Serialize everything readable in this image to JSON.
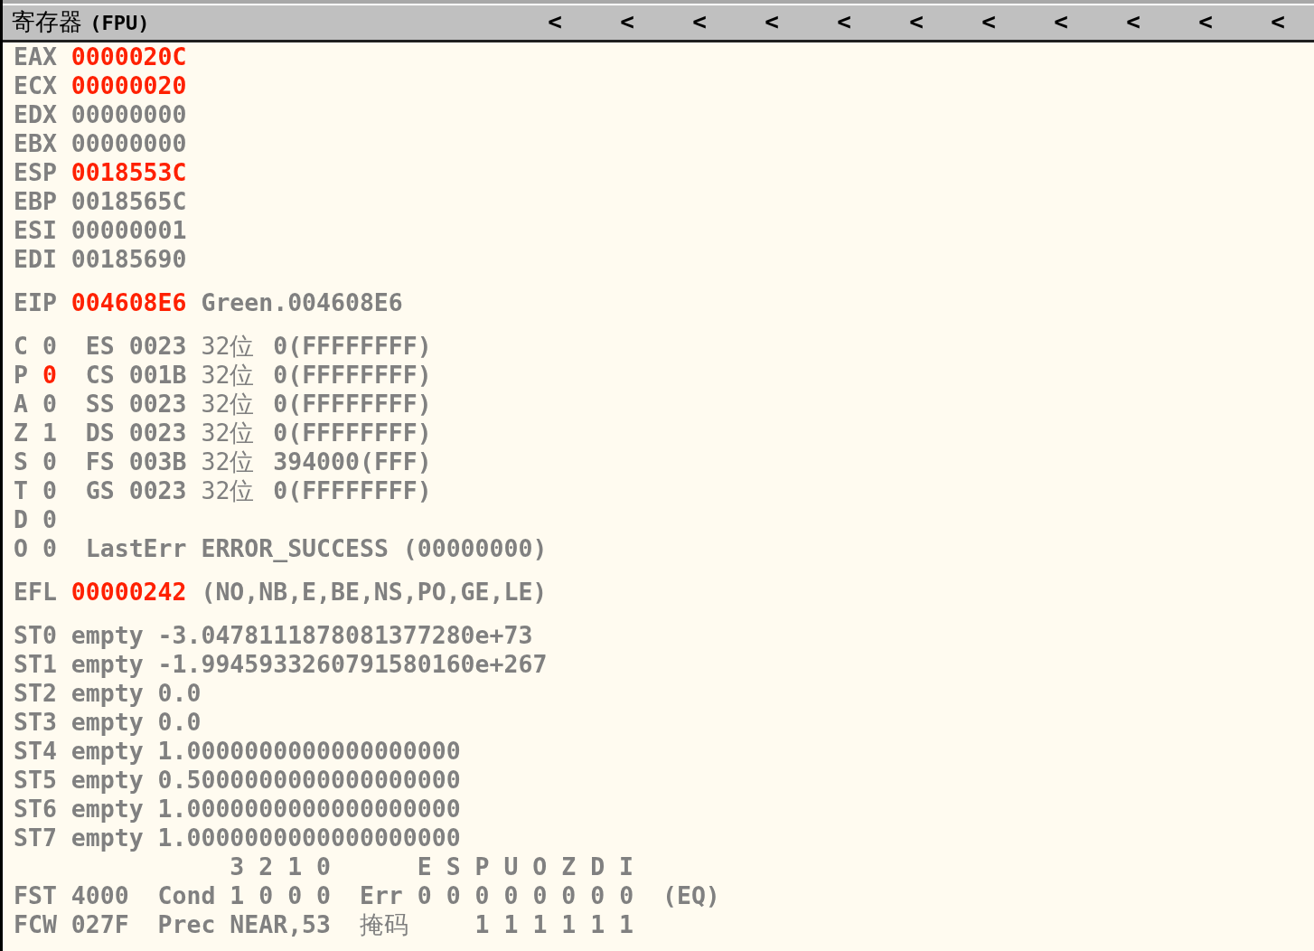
{
  "title": "寄存器 **(FPU)**",
  "scroll_buttons": [
    "<",
    "<",
    "<",
    "<",
    "<",
    "<",
    "<",
    "<",
    "<",
    "<",
    "<"
  ],
  "registers": [
    {
      "name": "EAX",
      "value": "0000020C",
      "changed": true
    },
    {
      "name": "ECX",
      "value": "00000020",
      "changed": true
    },
    {
      "name": "EDX",
      "value": "00000000",
      "changed": false
    },
    {
      "name": "EBX",
      "value": "00000000",
      "changed": false
    },
    {
      "name": "ESP",
      "value": "0018553C",
      "changed": true
    },
    {
      "name": "EBP",
      "value": "0018565C",
      "changed": false
    },
    {
      "name": "ESI",
      "value": "00000001",
      "changed": false
    },
    {
      "name": "EDI",
      "value": "00185690",
      "changed": false
    }
  ],
  "eip": {
    "name": "EIP",
    "value": "004608E6",
    "changed": true,
    "comment": "Green.004608E6"
  },
  "flags": [
    {
      "name": "C",
      "value": "0",
      "changed": false,
      "segment": {
        "name": "ES",
        "selector": "0023",
        "bits": "32位",
        "base": "0(FFFFFFFF)"
      }
    },
    {
      "name": "P",
      "value": "0",
      "changed": true,
      "segment": {
        "name": "CS",
        "selector": "001B",
        "bits": "32位",
        "base": "0(FFFFFFFF)"
      }
    },
    {
      "name": "A",
      "value": "0",
      "changed": false,
      "segment": {
        "name": "SS",
        "selector": "0023",
        "bits": "32位",
        "base": "0(FFFFFFFF)"
      }
    },
    {
      "name": "Z",
      "value": "1",
      "changed": false,
      "segment": {
        "name": "DS",
        "selector": "0023",
        "bits": "32位",
        "base": "0(FFFFFFFF)"
      }
    },
    {
      "name": "S",
      "value": "0",
      "changed": false,
      "segment": {
        "name": "FS",
        "selector": "003B",
        "bits": "32位",
        "base": "394000(FFF)"
      }
    },
    {
      "name": "T",
      "value": "0",
      "changed": false,
      "segment": {
        "name": "GS",
        "selector": "0023",
        "bits": "32位",
        "base": "0(FFFFFFFF)"
      }
    },
    {
      "name": "D",
      "value": "0",
      "changed": false
    },
    {
      "name": "O",
      "value": "0",
      "changed": false,
      "last_error": {
        "label": "LastErr",
        "value": "ERROR_SUCCESS (00000000)"
      }
    }
  ],
  "efl": {
    "name": "EFL",
    "value": "00000242",
    "changed": true,
    "conditions": "(NO,NB,E,BE,NS,PO,GE,LE)"
  },
  "fpu_stack": [
    {
      "name": "ST0",
      "tag": "empty",
      "value": "-3.0478111878081377280e+73"
    },
    {
      "name": "ST1",
      "tag": "empty",
      "value": "-1.9945933260791580160e+267"
    },
    {
      "name": "ST2",
      "tag": "empty",
      "value": "0.0"
    },
    {
      "name": "ST3",
      "tag": "empty",
      "value": "0.0"
    },
    {
      "name": "ST4",
      "tag": "empty",
      "value": "1.0000000000000000000"
    },
    {
      "name": "ST5",
      "tag": "empty",
      "value": "0.5000000000000000000"
    },
    {
      "name": "ST6",
      "tag": "empty",
      "value": "1.0000000000000000000"
    },
    {
      "name": "ST7",
      "tag": "empty",
      "value": "1.0000000000000000000"
    }
  ],
  "fpu_status": {
    "cond_header": "3 2 1 0",
    "err_header": "E S P U O Z D I",
    "fst": {
      "name": "FST",
      "value": "4000",
      "cond_label": "Cond",
      "cond_bits": "1 0 0 0",
      "err_label": "Err",
      "err_bits": "0 0 0 0 0 0 0 0",
      "result": "(EQ)"
    },
    "fcw": {
      "name": "FCW",
      "value": "027F",
      "prec_label": "Prec",
      "precision": "NEAR,53",
      "mask_label": "掩码",
      "mask_bits": "1 1 1 1 1 1"
    }
  }
}
